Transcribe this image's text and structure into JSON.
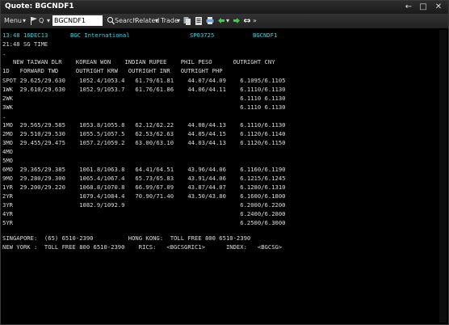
{
  "window": {
    "title": "Quote: BGCNDF1",
    "minimize": "←",
    "maximize": "□",
    "close": "✕"
  },
  "toolbar": {
    "menu": "Menu",
    "dropdown": "▾",
    "q": "Q",
    "ric_value": "BGCNDF1",
    "search": "Search",
    "related": "Related",
    "trade": "Trade",
    "more": "»"
  },
  "screen": {
    "line_time": "13:48",
    "line_date": "16DEC13",
    "line_source": "BGC International",
    "line_code": "SP03725",
    "line_ric": "BGCNDF1",
    "time_label": "21:48 SG TIME",
    "dot": ".",
    "hdr1": "   NEW TAIWAN DLR    KOREAN WON    INDIAN RUPEE    PHIL PESO      OUTRIGHT CNY",
    "hdr2": "1D   FORWARD TWD     OUTRIGHT KRW   OUTRIGHT INR   OUTRIGHT PHP",
    "rows": [
      "SPOT 29.625/29.630    1052.4/1053.4   61.79/61.81    44.07/44.09    6.1095/6.1105",
      "1WK  29.610/29.630    1052.9/1053.7   61.76/61.86    44.06/44.11    6.1110/6.1130",
      "2WK                                                                 6.1110 6.1130",
      "3WK                                                                 6.1110 6.1130",
      ".",
      "1MO  29.565/29.585    1053.8/1055.8   62.12/62.22    44.08/44.13    6.1110/6.1130",
      "2MO  29.510/29.530    1055.5/1057.5   62.53/62.63    44.05/44.15    6.1120/6.1140",
      "3MO  29.455/29.475    1057.2/1059.2   63.00/63.10    44.03/44.13    6.1120/6.1150",
      "4MO",
      "5MO",
      "6MO  29.365/29.385    1061.8/1063.8   64.41/64.51    43.96/44.06    6.1160/6.1190",
      "9MO  29.280/29.300    1065.4/1067.4   65.73/65.83    43.91/44.06    6.1215/6.1245",
      "1YR  29.200/29.220    1068.8/1070.8   66.99/67.09    43.87/44.07    6.1280/6.1310",
      "2YR                   1079.4/1084.4   70.90/71.40    43.50/43.80    6.1600/6.1800",
      "3YR                   1082.9/1092.9                                 6.2000/6.2200",
      "4YR                                                                 6.2400/6.2800",
      "5YR                                                                 6.2500/6.3000"
    ],
    "footer1": "SINGAPORE:  (65) 6510-2390          HONG KONG:  TOLL FREE 800 6510-2390",
    "footer2": "NEW YORK :  TOLL FREE 800 6510-2390    RICS:   <BGCSGRIC1>      INDEX:   <BGCSG>"
  },
  "colors": {
    "accent": "#2fd6e4",
    "text": "#dcdcdc",
    "background": "#000000"
  }
}
